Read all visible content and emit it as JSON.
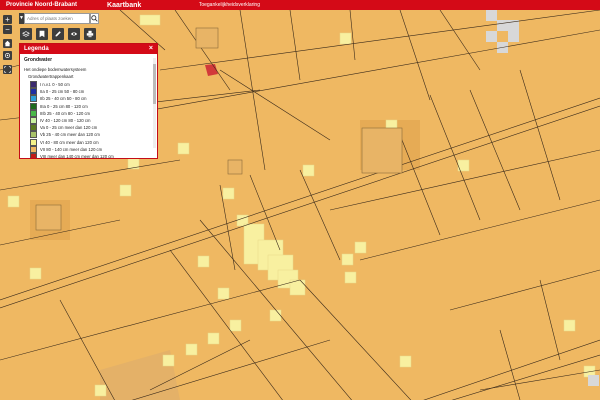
{
  "topbar": {
    "brand": "Provincie Noord-Brabant",
    "app_title": "Kaartbank",
    "links": [
      "Toegankelijkheidsverklaring"
    ]
  },
  "search": {
    "placeholder": "Adres of plaats zoeken",
    "toggle_icon": "chevron-down-icon",
    "button_icon": "search-icon"
  },
  "controls": {
    "zoom_in": "+",
    "zoom_out": "−"
  },
  "tools": [
    {
      "name": "layers-tool",
      "icon": "layers-icon"
    },
    {
      "name": "bookmark-tool",
      "icon": "bookmark-icon"
    },
    {
      "name": "draw-tool",
      "icon": "pencil-icon"
    },
    {
      "name": "view-tool",
      "icon": "eye-icon"
    },
    {
      "name": "print-tool",
      "icon": "printer-icon"
    }
  ],
  "legend": {
    "title": "Legenda",
    "close": "×",
    "layer_title": "Grondwater",
    "subtitle": "Het ondiepe bodemwatersysteem",
    "group_label": "Grondwatertrappenkaart",
    "items": [
      {
        "label": "I n.v.t. 0 - 50 cm",
        "color": "#3b2a6e"
      },
      {
        "label": "IIa 0 - 25 cm 50 - 80 cm",
        "color": "#1f2fa3"
      },
      {
        "label": "IIb 25 - 40 cm 50 - 80 cm",
        "color": "#2ea0d8"
      },
      {
        "label": "IIIa 0 - 25 cm 80 - 120 cm",
        "color": "#1d6b1d"
      },
      {
        "label": "IIIb 25 - 40 cm 80 - 120 cm",
        "color": "#49b849"
      },
      {
        "label": "IV 40 - 120 cm 80 - 120 cm",
        "color": "#c9f2a0"
      },
      {
        "label": "Va 0 - 25 cm meer dan 120 cm",
        "color": "#5b7a22"
      },
      {
        "label": "Vb 25 - 40 cm meer dan 120 cm",
        "color": "#a8c26a"
      },
      {
        "label": "VI 40 - 80 cm meer dan 120 cm",
        "color": "#f4f38a"
      },
      {
        "label": "VII 80 - 140 cm meer dan 120 cm",
        "color": "#efb862"
      },
      {
        "label": "VIII meer dan 140 cm meer dan 120 cm",
        "color": "#c21d18"
      }
    ]
  },
  "map": {
    "base_color": "#efb862",
    "line_color": "#3a2a1a",
    "patch_color": "#f8f0a0"
  }
}
